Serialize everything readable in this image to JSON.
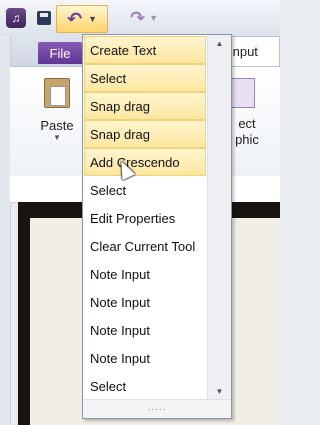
{
  "quick_access": {
    "app_icon_glyph": "♫",
    "undo_glyph": "↶",
    "redo_glyph": "↷",
    "dropdown_glyph": "▼"
  },
  "tabs": {
    "file": "File",
    "input": "Input"
  },
  "ribbon": {
    "paste_label": "Paste",
    "paste_drop": "▼",
    "select_graphic_label": "ect\nphic"
  },
  "undo_menu": {
    "items": [
      {
        "label": "Create Text",
        "highlighted": true
      },
      {
        "label": "Select",
        "highlighted": true
      },
      {
        "label": "Snap drag",
        "highlighted": true
      },
      {
        "label": "Snap drag",
        "highlighted": true
      },
      {
        "label": "Add Crescendo",
        "highlighted": true
      },
      {
        "label": "Select",
        "highlighted": false
      },
      {
        "label": "Edit Properties",
        "highlighted": false
      },
      {
        "label": "Clear Current Tool",
        "highlighted": false
      },
      {
        "label": "Note Input",
        "highlighted": false
      },
      {
        "label": "Note Input",
        "highlighted": false
      },
      {
        "label": "Note Input",
        "highlighted": false
      },
      {
        "label": "Note Input",
        "highlighted": false
      },
      {
        "label": "Select",
        "highlighted": false
      }
    ],
    "scroll_up": "▲",
    "scroll_down": "▼",
    "grip": "....."
  },
  "colors": {
    "highlight": "#fde7a0",
    "file_tab": "#6b3f9e",
    "undo_button": "#ffd36b"
  }
}
